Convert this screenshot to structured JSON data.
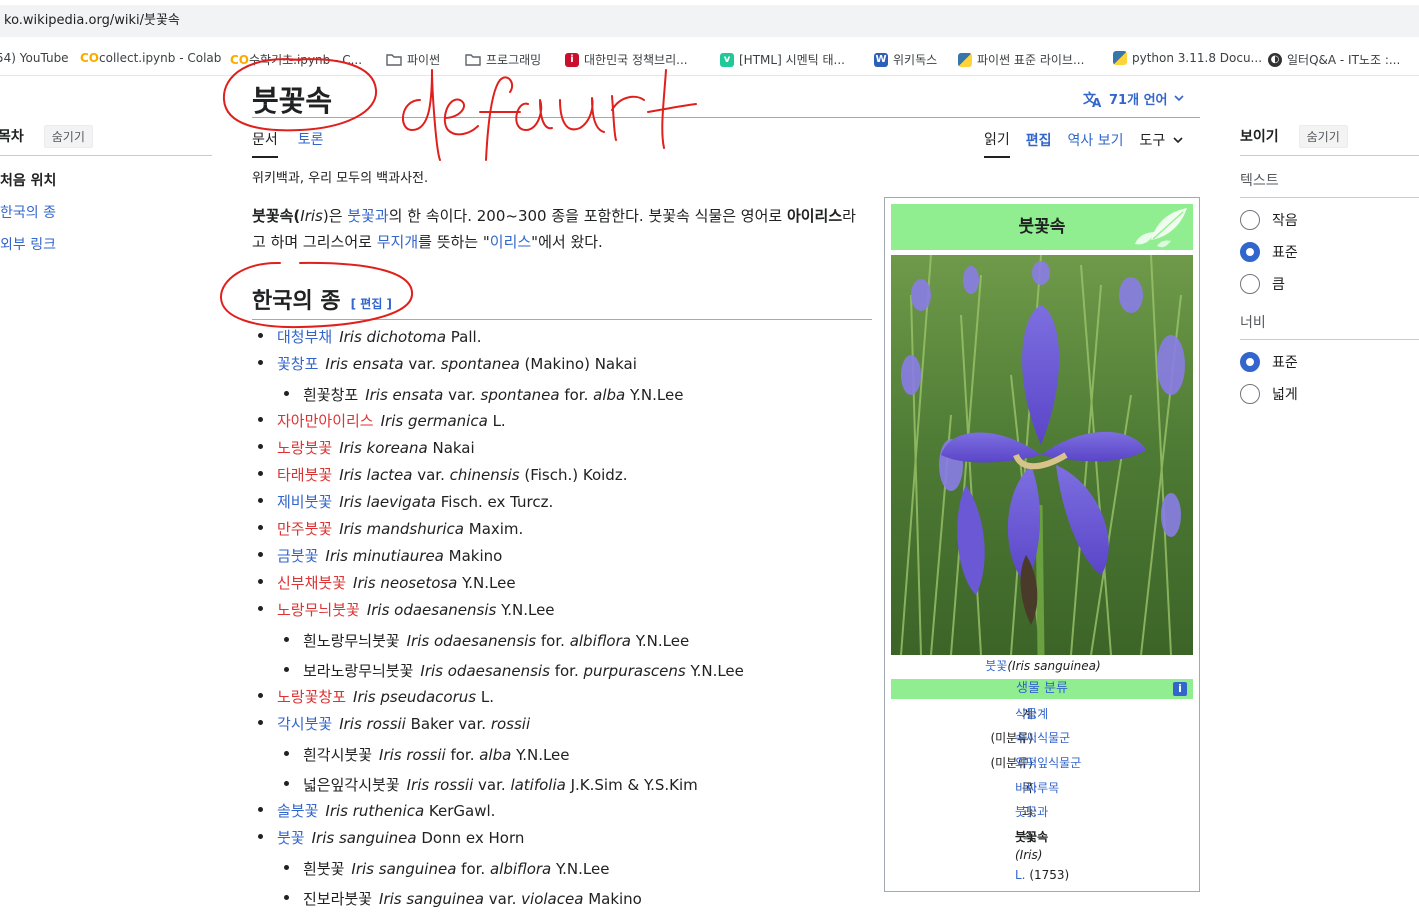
{
  "browser": {
    "url": "ko.wikipedia.org/wiki/붓꽃속",
    "bookmarks": [
      {
        "label": "54) YouTube",
        "icon": "youtube-icon"
      },
      {
        "label": "collect.ipynb - Colab",
        "icon": "colab-icon"
      },
      {
        "label": "수학기초.ipynb - C...",
        "icon": "colab-icon"
      },
      {
        "label": "파이썬",
        "icon": "folder-icon"
      },
      {
        "label": "프로그래밍",
        "icon": "folder-icon"
      },
      {
        "label": "대한민국 정책브리...",
        "icon": "korea-gov-icon"
      },
      {
        "label": "[HTML] 시멘틱 태...",
        "icon": "velog-icon"
      },
      {
        "label": "위키독스",
        "icon": "wikidocs-icon"
      },
      {
        "label": "파이썬 표준 라이브...",
        "icon": "python-icon"
      },
      {
        "label": "python 3.11.8 Docu...",
        "icon": "python-icon"
      },
      {
        "label": "일터Q&A - IT노조 :...",
        "icon": "globe-icon"
      }
    ]
  },
  "toc": {
    "title": "목차",
    "hide": "숨기기",
    "items": [
      "처음 위치",
      "한국의 종",
      "외부 링크"
    ]
  },
  "page": {
    "title": "붓꽃속",
    "languages": "71개 언어",
    "tabs_left": [
      "문서",
      "토론"
    ],
    "tabs_right": [
      "읽기",
      "편집",
      "역사 보기",
      "도구"
    ],
    "tagline": "위키백과, 우리 모두의 백과사전.",
    "intro": {
      "t1": "붓꽃속(",
      "t2": "Iris",
      "t3": ")은 ",
      "link1": "붓꽃과",
      "t4": "의 한 속이다. 200~300 종을 포함한다. 붓꽃속 식물은 영어로 ",
      "bold1": "아이리스",
      "t5": "라고 하며 그리스어로 ",
      "link2": "무지개",
      "t6": "를 뜻하는 \"",
      "link3": "이리스",
      "t7": "\"에서 왔다."
    },
    "section_heading": "한국의 종",
    "edit_label": "[ 편집 ]"
  },
  "species": [
    {
      "level": 1,
      "name": "대청부채",
      "color": "blue",
      "sci": "Iris dichotoma",
      "auth": " Pall."
    },
    {
      "level": 1,
      "name": "꽃창포",
      "color": "blue",
      "sci": "Iris ensata",
      "auth": " var. ",
      "sci2": "spontanea",
      "auth2": " (Makino) Nakai"
    },
    {
      "level": 2,
      "name": "흰꽃창포",
      "color": "black",
      "sci": "Iris ensata",
      "auth": " var. ",
      "sci2": "spontanea",
      "auth2": " for. ",
      "sci3": "alba",
      "auth3": " Y.N.Lee"
    },
    {
      "level": 1,
      "name": "자아만아이리스",
      "color": "red",
      "sci": "Iris germanica",
      "auth": " L."
    },
    {
      "level": 1,
      "name": "노랑붓꽃",
      "color": "red",
      "sci": "Iris koreana",
      "auth": " Nakai"
    },
    {
      "level": 1,
      "name": "타래붓꽃",
      "color": "red",
      "sci": "Iris lactea",
      "auth": " var. ",
      "sci2": "chinensis",
      "auth2": " (Fisch.) Koidz."
    },
    {
      "level": 1,
      "name": "제비붓꽃",
      "color": "blue",
      "sci": "Iris laevigata",
      "auth": " Fisch. ex Turcz."
    },
    {
      "level": 1,
      "name": "만주붓꽃",
      "color": "red",
      "sci": "Iris mandshurica",
      "auth": " Maxim."
    },
    {
      "level": 1,
      "name": "금붓꽃",
      "color": "blue",
      "sci": "Iris minutiaurea",
      "auth": " Makino"
    },
    {
      "level": 1,
      "name": "신부채붓꽃",
      "color": "red",
      "sci": "Iris neosetosa",
      "auth": " Y.N.Lee"
    },
    {
      "level": 1,
      "name": "노랑무늬붓꽃",
      "color": "red",
      "sci": "Iris odaesanensis",
      "auth": " Y.N.Lee"
    },
    {
      "level": 2,
      "name": "흰노랑무늬붓꽃",
      "color": "black",
      "sci": "Iris odaesanensis",
      "auth": " for. ",
      "sci2": "albiflora",
      "auth2": " Y.N.Lee"
    },
    {
      "level": 2,
      "name": "보라노랑무늬붓꽃",
      "color": "black",
      "sci": "Iris odaesanensis",
      "auth": " for. ",
      "sci2": "purpurascens",
      "auth2": " Y.N.Lee"
    },
    {
      "level": 1,
      "name": "노랑꽃창포",
      "color": "red",
      "sci": "Iris pseudacorus",
      "auth": " L."
    },
    {
      "level": 1,
      "name": "각시붓꽃",
      "color": "blue",
      "sci": "Iris rossii",
      "auth": " Baker var. ",
      "sci2": "rossii"
    },
    {
      "level": 2,
      "name": "흰각시붓꽃",
      "color": "black",
      "sci": "Iris rossii",
      "auth": " for. ",
      "sci2": "alba",
      "auth2": " Y.N.Lee"
    },
    {
      "level": 2,
      "name": "넓은잎각시붓꽃",
      "color": "black",
      "sci": "Iris rossii",
      "auth": " var. ",
      "sci2": "latifolia",
      "auth2": " J.K.Sim & Y.S.Kim"
    },
    {
      "level": 1,
      "name": "솔붓꽃",
      "color": "blue",
      "sci": "Iris ruthenica",
      "auth": " KerGawl."
    },
    {
      "level": 1,
      "name": "붓꽃",
      "color": "blue",
      "sci": "Iris sanguinea",
      "auth": " Donn ex Horn"
    },
    {
      "level": 2,
      "name": "흰붓꽃",
      "color": "black",
      "sci": "Iris sanguinea",
      "auth": " for. ",
      "sci2": "albiflora",
      "auth2": " Y.N.Lee"
    },
    {
      "level": 2,
      "name": "진보라붓꽃",
      "color": "black",
      "sci": "Iris sanguinea",
      "auth": " var. ",
      "sci2": "violacea",
      "auth2": " Makino"
    }
  ],
  "infobox": {
    "title": "붓꽃속",
    "caption_link": "붓꽃",
    "caption_sci": "(Iris sanguinea)",
    "classification": "생물 분류",
    "info_icon": "i",
    "ranks": [
      {
        "label": "계:",
        "value": "식물계",
        "link": true
      },
      {
        "label": "(미분류):",
        "value": "속씨식물군",
        "link": true
      },
      {
        "label": "(미분류):",
        "value": "외떡잎식물군",
        "link": true
      },
      {
        "label": "목:",
        "value": "비짜루목",
        "link": true
      },
      {
        "label": "과:",
        "value": "붓꽃과",
        "link": true
      },
      {
        "label": "속:",
        "value": "붓꽃속",
        "link": false
      }
    ],
    "genus_sci": "(Iris)",
    "author_link": "L.",
    "author_year": " (1753)"
  },
  "appearance": {
    "title": "보이기",
    "hide": "숨기기",
    "text_label": "텍스트",
    "text_options": [
      {
        "label": "작음",
        "selected": false
      },
      {
        "label": "표준",
        "selected": true
      },
      {
        "label": "큼",
        "selected": false
      }
    ],
    "width_label": "너비",
    "width_options": [
      {
        "label": "표준",
        "selected": true
      },
      {
        "label": "넓게",
        "selected": false
      }
    ]
  },
  "annotation": {
    "handwritten": "default",
    "color": "#e0201c"
  },
  "colors": {
    "link": "#3366cc",
    "redlink": "#d33",
    "infobox_green": "#90ee90"
  }
}
